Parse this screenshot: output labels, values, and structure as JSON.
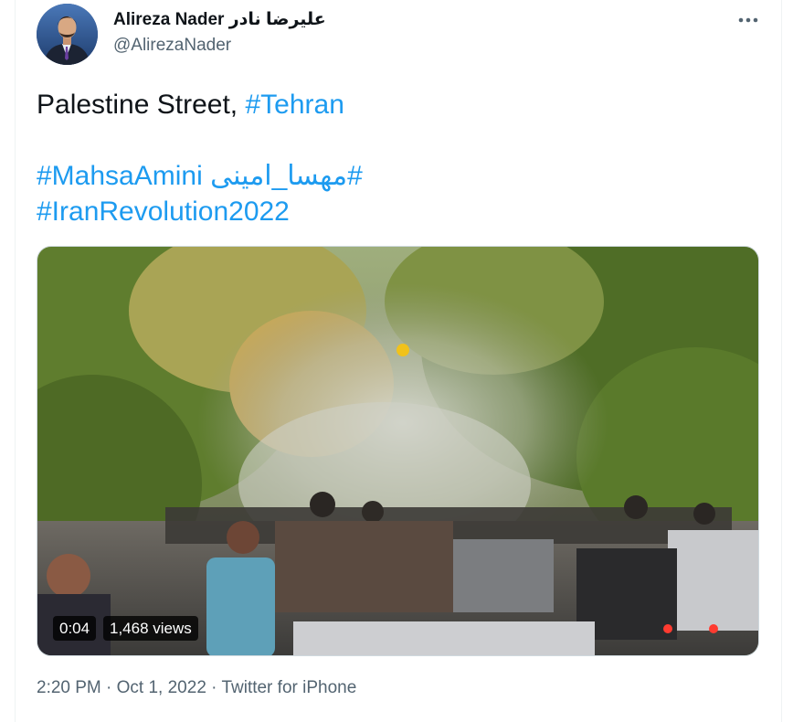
{
  "author": {
    "display_name": "Alireza Nader علیرضا نادر",
    "handle": "@AlirezaNader"
  },
  "tweet": {
    "text_prefix": "Palestine Street, ",
    "hashtag_tehran": "#Tehran",
    "hashtag_mahsa": "#MahsaAmini مهسا_امینی#",
    "hashtag_revolution": "#IranRevolution2022"
  },
  "video": {
    "duration": "0:04",
    "views": "1,468 views"
  },
  "meta": {
    "time": "2:20 PM",
    "separator": " · ",
    "date": "Oct 1, 2022",
    "source": "Twitter for iPhone"
  },
  "icons": {
    "more": "more-horizontal-icon",
    "avatar": "profile-photo"
  },
  "colors": {
    "link": "#1d9bf0",
    "secondary_text": "#536471",
    "primary_text": "#0f1419"
  }
}
